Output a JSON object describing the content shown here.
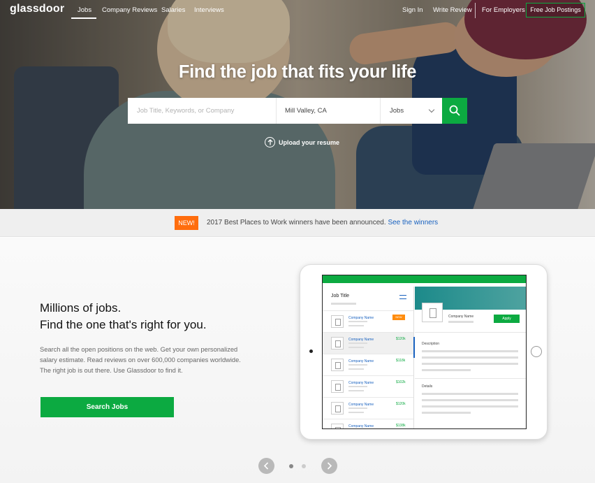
{
  "nav": {
    "logo": "glassdoor",
    "links": [
      "Jobs",
      "Company Reviews",
      "Salaries",
      "Interviews"
    ],
    "right_links": [
      "Sign In",
      "Write Review",
      "For Employers"
    ],
    "cta": "Free Job Postings"
  },
  "hero": {
    "title": "Find the job that fits your life",
    "search": {
      "keyword_placeholder": "Job Title, Keywords, or Company",
      "location_value": "Mill Valley, CA",
      "type_value": "Jobs",
      "search_icon": "search-icon"
    },
    "upload": "Upload your resume"
  },
  "announcement": {
    "badge": "NEW!",
    "text": "2017 Best Places to Work winners have been announced.",
    "link": "See the winners"
  },
  "feature": {
    "headline_1": "Millions of jobs.",
    "headline_2": "Find the one that's right for you.",
    "body": "Search all the open positions on the web. Get your own personalized salary estimate. Read reviews on over 600,000 companies worldwide. The right job is out there. Use Glassdoor to find it.",
    "button": "Search Jobs"
  },
  "tablet": {
    "job_title": "Job Title",
    "jobs": [
      {
        "company": "Company Name",
        "salary": "",
        "badge": "NEW"
      },
      {
        "company": "Company Name",
        "salary": "$120k",
        "badge": ""
      },
      {
        "company": "Company Name",
        "salary": "$118k",
        "badge": ""
      },
      {
        "company": "Company Name",
        "salary": "$102k",
        "badge": ""
      },
      {
        "company": "Company Name",
        "salary": "$120k",
        "badge": ""
      },
      {
        "company": "Company Name",
        "salary": "$138k",
        "badge": ""
      }
    ],
    "detail_company": "Company Name",
    "apply": "Apply",
    "description": "Description",
    "details": "Details"
  },
  "colors": {
    "brand_green": "#0caa41",
    "new_orange": "#ff6d0d",
    "link_blue": "#1861bf"
  }
}
